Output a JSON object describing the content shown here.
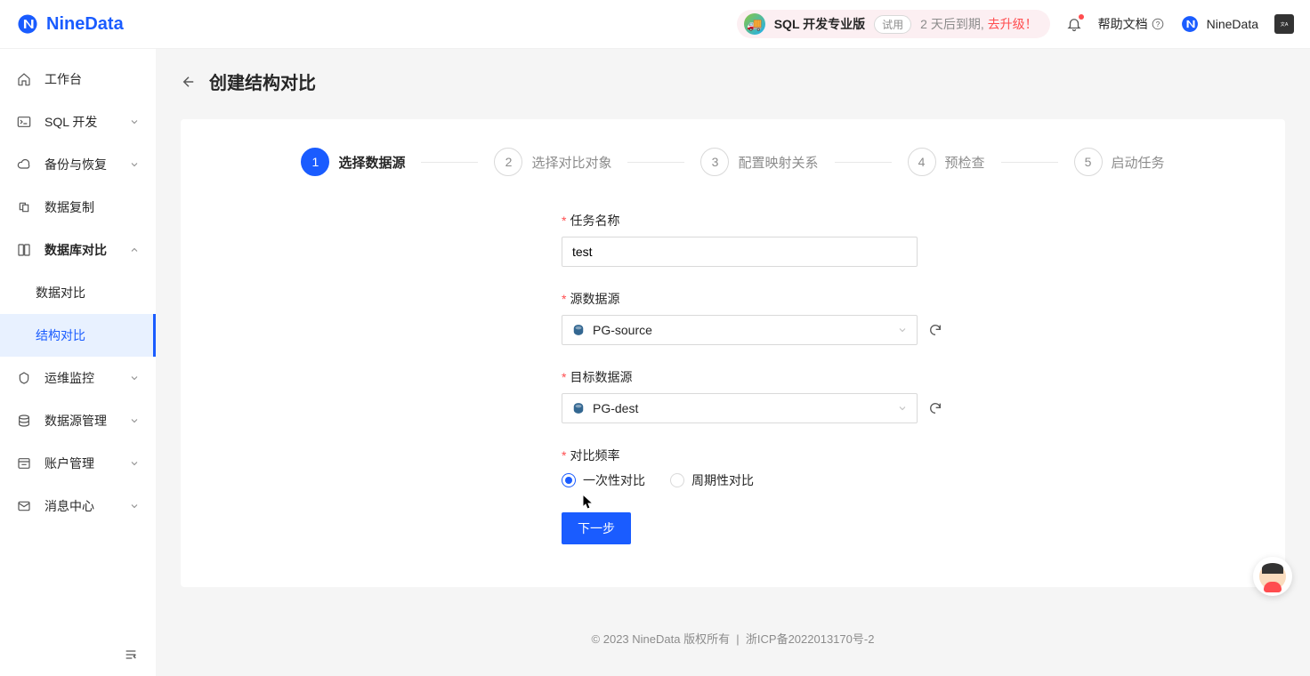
{
  "header": {
    "logo_text": "NineData",
    "banner_title": "SQL 开发专业版",
    "trial_chip": "试用",
    "expire_text": "2 天后到期, ",
    "upgrade_text": "去升级！",
    "help_text": "帮助文档",
    "username": "NineData"
  },
  "sidebar": {
    "items": [
      {
        "label": "工作台",
        "icon": "home"
      },
      {
        "label": "SQL 开发",
        "icon": "terminal",
        "expandable": true
      },
      {
        "label": "备份与恢复",
        "icon": "cloud",
        "expandable": true
      },
      {
        "label": "数据复制",
        "icon": "copy"
      },
      {
        "label": "数据库对比",
        "icon": "compare",
        "expandable": true,
        "expanded": true,
        "children": [
          {
            "label": "数据对比"
          },
          {
            "label": "结构对比",
            "active": true
          }
        ]
      },
      {
        "label": "运维监控",
        "icon": "monitor",
        "expandable": true
      },
      {
        "label": "数据源管理",
        "icon": "datasource",
        "expandable": true
      },
      {
        "label": "账户管理",
        "icon": "account",
        "expandable": true
      },
      {
        "label": "消息中心",
        "icon": "mail",
        "expandable": true
      }
    ]
  },
  "page": {
    "title": "创建结构对比",
    "steps": [
      {
        "num": "1",
        "label": "选择数据源"
      },
      {
        "num": "2",
        "label": "选择对比对象"
      },
      {
        "num": "3",
        "label": "配置映射关系"
      },
      {
        "num": "4",
        "label": "预检查"
      },
      {
        "num": "5",
        "label": "启动任务"
      }
    ],
    "form": {
      "task_name_label": "任务名称",
      "task_name_value": "test",
      "source_label": "源数据源",
      "source_value": "PG-source",
      "target_label": "目标数据源",
      "target_value": "PG-dest",
      "freq_label": "对比频率",
      "freq_option1": "一次性对比",
      "freq_option2": "周期性对比",
      "next_button": "下一步"
    }
  },
  "footer": {
    "copyright": "© 2023 NineData 版权所有",
    "icp": "浙ICP备2022013170号-2"
  }
}
